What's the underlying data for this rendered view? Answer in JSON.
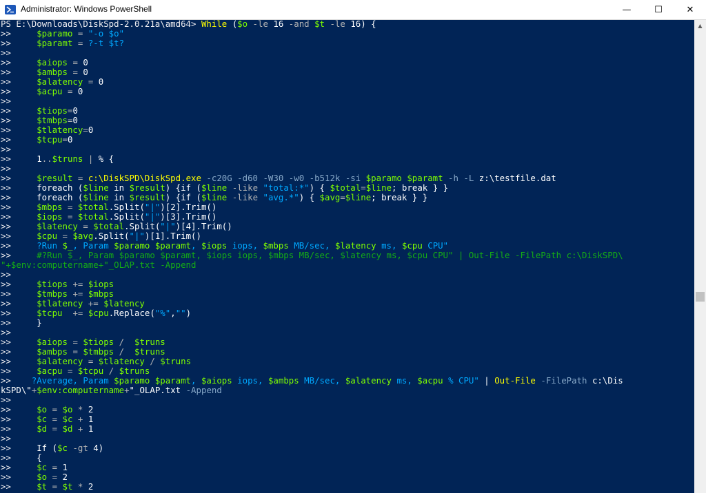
{
  "window": {
    "title": "Administrator: Windows PowerShell",
    "minimize_label": "—",
    "maximize_label": "☐",
    "close_label": "✕",
    "icon": "powershell-icon"
  },
  "colors": {
    "background": "#012456",
    "variable": "#7fff00",
    "string": "#00a8ff",
    "keyword": "#ffff00",
    "operator": "#b4b4b4",
    "comment": "#15ad15",
    "text": "#ffffff"
  },
  "console": {
    "lines": [
      [
        [
          "p",
          "PS E:\\Downloads\\DiskSpd-2.0.21a\\amd64> "
        ],
        [
          "k",
          "While"
        ],
        [
          "n",
          " ("
        ],
        [
          "v",
          "$o"
        ],
        [
          "o",
          " -le "
        ],
        [
          "n",
          "16"
        ],
        [
          "o",
          " -and "
        ],
        [
          "v",
          "$t"
        ],
        [
          "o",
          " -le "
        ],
        [
          "n",
          "16) {"
        ]
      ],
      [
        [
          "p",
          ">>     "
        ],
        [
          "v",
          "$paramo"
        ],
        [
          "o",
          " = "
        ],
        [
          "s",
          "\"-o $o\""
        ]
      ],
      [
        [
          "p",
          ">>     "
        ],
        [
          "v",
          "$paramt"
        ],
        [
          "o",
          " = "
        ],
        [
          "s",
          "?-t $t?"
        ]
      ],
      [
        [
          "p",
          ">>"
        ]
      ],
      [
        [
          "p",
          ">>     "
        ],
        [
          "v",
          "$aiops"
        ],
        [
          "o",
          " = "
        ],
        [
          "n",
          "0"
        ]
      ],
      [
        [
          "p",
          ">>     "
        ],
        [
          "v",
          "$ambps"
        ],
        [
          "o",
          " = "
        ],
        [
          "n",
          "0"
        ]
      ],
      [
        [
          "p",
          ">>     "
        ],
        [
          "v",
          "$alatency"
        ],
        [
          "o",
          " = "
        ],
        [
          "n",
          "0"
        ]
      ],
      [
        [
          "p",
          ">>     "
        ],
        [
          "v",
          "$acpu"
        ],
        [
          "o",
          " = "
        ],
        [
          "n",
          "0"
        ]
      ],
      [
        [
          "p",
          ">>"
        ]
      ],
      [
        [
          "p",
          ">>     "
        ],
        [
          "v",
          "$tiops"
        ],
        [
          "o",
          "="
        ],
        [
          "n",
          "0"
        ]
      ],
      [
        [
          "p",
          ">>     "
        ],
        [
          "v",
          "$tmbps"
        ],
        [
          "o",
          "="
        ],
        [
          "n",
          "0"
        ]
      ],
      [
        [
          "p",
          ">>     "
        ],
        [
          "v",
          "$tlatency"
        ],
        [
          "o",
          "="
        ],
        [
          "n",
          "0"
        ]
      ],
      [
        [
          "p",
          ">>     "
        ],
        [
          "v",
          "$tcpu"
        ],
        [
          "o",
          "="
        ],
        [
          "n",
          "0"
        ]
      ],
      [
        [
          "p",
          ">>"
        ]
      ],
      [
        [
          "p",
          ">>     "
        ],
        [
          "n",
          "1"
        ],
        [
          "o",
          ".."
        ],
        [
          "v",
          "$truns"
        ],
        [
          "o",
          " | "
        ],
        [
          "n",
          "% {"
        ]
      ],
      [
        [
          "p",
          ">>"
        ]
      ],
      [
        [
          "p",
          ">>     "
        ],
        [
          "v",
          "$result"
        ],
        [
          "o",
          " = "
        ],
        [
          "k",
          "c:\\DiskSPD\\DiskSpd.exe"
        ],
        [
          "g",
          " -c20G -d60 -W30 -w0 -b512k -si "
        ],
        [
          "v",
          "$paramo $paramt"
        ],
        [
          "g",
          " -h -L "
        ],
        [
          "n",
          "z:\\testfile.dat"
        ]
      ],
      [
        [
          "p",
          ">>     "
        ],
        [
          "n",
          "foreach ("
        ],
        [
          "v",
          "$line"
        ],
        [
          "n",
          " in "
        ],
        [
          "v",
          "$result"
        ],
        [
          "n",
          ") {if ("
        ],
        [
          "v",
          "$line"
        ],
        [
          "o",
          " -like "
        ],
        [
          "s",
          "\"total:*\""
        ],
        [
          "n",
          ") { "
        ],
        [
          "v",
          "$total"
        ],
        [
          "o",
          "="
        ],
        [
          "v",
          "$line"
        ],
        [
          "n",
          "; break } }"
        ]
      ],
      [
        [
          "p",
          ">>     "
        ],
        [
          "n",
          "foreach ("
        ],
        [
          "v",
          "$line"
        ],
        [
          "n",
          " in "
        ],
        [
          "v",
          "$result"
        ],
        [
          "n",
          ") {if ("
        ],
        [
          "v",
          "$line"
        ],
        [
          "o",
          " -like "
        ],
        [
          "s",
          "\"avg.*\""
        ],
        [
          "n",
          ") { "
        ],
        [
          "v",
          "$avg"
        ],
        [
          "o",
          "="
        ],
        [
          "v",
          "$line"
        ],
        [
          "n",
          "; break } }"
        ]
      ],
      [
        [
          "p",
          ">>     "
        ],
        [
          "v",
          "$mbps"
        ],
        [
          "o",
          " = "
        ],
        [
          "v",
          "$total"
        ],
        [
          "n",
          ".Split("
        ],
        [
          "s",
          "\"|\""
        ],
        [
          "n",
          ")[2].Trim()"
        ]
      ],
      [
        [
          "p",
          ">>     "
        ],
        [
          "v",
          "$iops"
        ],
        [
          "o",
          " = "
        ],
        [
          "v",
          "$total"
        ],
        [
          "n",
          ".Split("
        ],
        [
          "s",
          "\"|\""
        ],
        [
          "n",
          ")[3].Trim()"
        ]
      ],
      [
        [
          "p",
          ">>     "
        ],
        [
          "v",
          "$latency"
        ],
        [
          "o",
          " = "
        ],
        [
          "v",
          "$total"
        ],
        [
          "n",
          ".Split("
        ],
        [
          "s",
          "\"|\""
        ],
        [
          "n",
          ")[4].Trim()"
        ]
      ],
      [
        [
          "p",
          ">>     "
        ],
        [
          "v",
          "$cpu"
        ],
        [
          "o",
          " = "
        ],
        [
          "v",
          "$avg"
        ],
        [
          "n",
          ".Split("
        ],
        [
          "s",
          "\"|\""
        ],
        [
          "n",
          ")[1].Trim()"
        ]
      ],
      [
        [
          "p",
          ">>     "
        ],
        [
          "s",
          "?Run "
        ],
        [
          "v",
          "$_"
        ],
        [
          "s",
          ", Param "
        ],
        [
          "v",
          "$paramo $paramt"
        ],
        [
          "s",
          ", "
        ],
        [
          "v",
          "$iops"
        ],
        [
          "s",
          " iops, "
        ],
        [
          "v",
          "$mbps"
        ],
        [
          "s",
          " MB/sec, "
        ],
        [
          "v",
          "$latency"
        ],
        [
          "s",
          " ms, "
        ],
        [
          "v",
          "$cpu"
        ],
        [
          "s",
          " CPU\""
        ]
      ],
      [
        [
          "p",
          ">>     "
        ],
        [
          "c",
          "#?Run $_, Param $paramo $paramt, $iops iops, $mbps MB/sec, $latency ms, $cpu CPU\" | Out-File -FilePath c:\\DiskSPD\\"
        ]
      ],
      [
        [
          "c",
          "\"+$env:computername+\"_OLAP.txt -Append"
        ]
      ],
      [
        [
          "p",
          ">>"
        ]
      ],
      [
        [
          "p",
          ">>     "
        ],
        [
          "v",
          "$tiops"
        ],
        [
          "o",
          " += "
        ],
        [
          "v",
          "$iops"
        ]
      ],
      [
        [
          "p",
          ">>     "
        ],
        [
          "v",
          "$tmbps"
        ],
        [
          "o",
          " += "
        ],
        [
          "v",
          "$mbps"
        ]
      ],
      [
        [
          "p",
          ">>     "
        ],
        [
          "v",
          "$tlatency"
        ],
        [
          "o",
          " += "
        ],
        [
          "v",
          "$latency"
        ]
      ],
      [
        [
          "p",
          ">>     "
        ],
        [
          "v",
          "$tcpu"
        ],
        [
          "o",
          "  += "
        ],
        [
          "v",
          "$cpu"
        ],
        [
          "n",
          ".Replace("
        ],
        [
          "s",
          "\"%\""
        ],
        [
          "n",
          ","
        ],
        [
          "s",
          "\"\""
        ],
        [
          "n",
          ")"
        ]
      ],
      [
        [
          "p",
          ">>     "
        ],
        [
          "n",
          "}"
        ]
      ],
      [
        [
          "p",
          ">>"
        ]
      ],
      [
        [
          "p",
          ">>     "
        ],
        [
          "v",
          "$aiops"
        ],
        [
          "o",
          " = "
        ],
        [
          "v",
          "$tiops"
        ],
        [
          "o",
          " /  "
        ],
        [
          "v",
          "$truns"
        ]
      ],
      [
        [
          "p",
          ">>     "
        ],
        [
          "v",
          "$ambps"
        ],
        [
          "o",
          " = "
        ],
        [
          "v",
          "$tmbps"
        ],
        [
          "o",
          " /  "
        ],
        [
          "v",
          "$truns"
        ]
      ],
      [
        [
          "p",
          ">>     "
        ],
        [
          "v",
          "$alatency"
        ],
        [
          "o",
          " = "
        ],
        [
          "v",
          "$tlatency"
        ],
        [
          "o",
          " / "
        ],
        [
          "v",
          "$truns"
        ]
      ],
      [
        [
          "p",
          ">>     "
        ],
        [
          "v",
          "$acpu"
        ],
        [
          "o",
          " = "
        ],
        [
          "v",
          "$tcpu"
        ],
        [
          "o",
          " / "
        ],
        [
          "v",
          "$truns"
        ]
      ],
      [
        [
          "p",
          ">>    "
        ],
        [
          "s",
          "?Average, Param "
        ],
        [
          "v",
          "$paramo $paramt"
        ],
        [
          "s",
          ", "
        ],
        [
          "v",
          "$aiops"
        ],
        [
          "s",
          " iops, "
        ],
        [
          "v",
          "$ambps"
        ],
        [
          "s",
          " MB/sec, "
        ],
        [
          "v",
          "$alatency"
        ],
        [
          "s",
          " ms, "
        ],
        [
          "v",
          "$acpu"
        ],
        [
          "s",
          " % CPU\""
        ],
        [
          "n",
          " | "
        ],
        [
          "k",
          "Out-File"
        ],
        [
          "g",
          " -FilePath "
        ],
        [
          "n",
          "c:\\Dis"
        ]
      ],
      [
        [
          "n",
          "kSPD\\\""
        ],
        [
          "o",
          "+"
        ],
        [
          "v",
          "$env:computername"
        ],
        [
          "o",
          "+"
        ],
        [
          "n",
          "\"_OLAP.txt"
        ],
        [
          "g",
          " -Append"
        ]
      ],
      [
        [
          "p",
          ">>"
        ]
      ],
      [
        [
          "p",
          ">>     "
        ],
        [
          "v",
          "$o"
        ],
        [
          "o",
          " = "
        ],
        [
          "v",
          "$o"
        ],
        [
          "o",
          " * "
        ],
        [
          "n",
          "2"
        ]
      ],
      [
        [
          "p",
          ">>     "
        ],
        [
          "v",
          "$c"
        ],
        [
          "o",
          " = "
        ],
        [
          "v",
          "$c"
        ],
        [
          "o",
          " + "
        ],
        [
          "n",
          "1"
        ]
      ],
      [
        [
          "p",
          ">>     "
        ],
        [
          "v",
          "$d"
        ],
        [
          "o",
          " = "
        ],
        [
          "v",
          "$d"
        ],
        [
          "o",
          " + "
        ],
        [
          "n",
          "1"
        ]
      ],
      [
        [
          "p",
          ">>"
        ]
      ],
      [
        [
          "p",
          ">>     "
        ],
        [
          "n",
          "If ("
        ],
        [
          "v",
          "$c"
        ],
        [
          "o",
          " -gt "
        ],
        [
          "n",
          "4)"
        ]
      ],
      [
        [
          "p",
          ">>     "
        ],
        [
          "n",
          "{"
        ]
      ],
      [
        [
          "p",
          ">>     "
        ],
        [
          "v",
          "$c"
        ],
        [
          "o",
          " = "
        ],
        [
          "n",
          "1"
        ]
      ],
      [
        [
          "p",
          ">>     "
        ],
        [
          "v",
          "$o"
        ],
        [
          "o",
          " = "
        ],
        [
          "n",
          "2"
        ]
      ],
      [
        [
          "p",
          ">>     "
        ],
        [
          "v",
          "$t"
        ],
        [
          "o",
          " = "
        ],
        [
          "v",
          "$t"
        ],
        [
          "o",
          " * "
        ],
        [
          "n",
          "2"
        ]
      ]
    ]
  },
  "scrollbar": {
    "up_arrow": "▲"
  }
}
